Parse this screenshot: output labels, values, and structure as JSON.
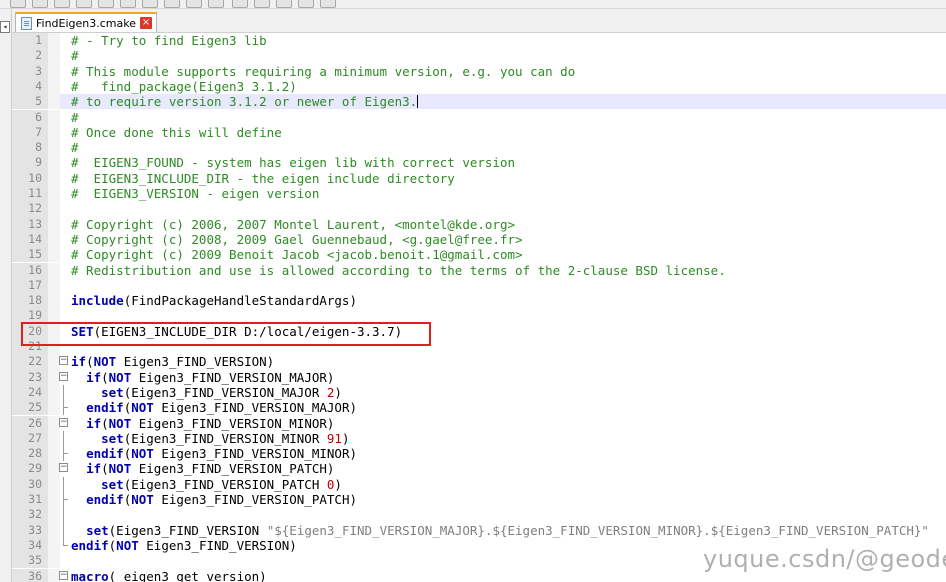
{
  "tab": {
    "label": "FindEigen3.cmake",
    "close_glyph": "×"
  },
  "watermark": "yuque.csdn/@geodev",
  "colors": {
    "comment": "#2e8b24",
    "keyword": "#0000b0",
    "number": "#c00000",
    "current_line": "#e8e8ff",
    "highlight_box": "#e02020",
    "tab_accent": "#f6a623"
  },
  "current_line": 5,
  "highlighted_line": 20,
  "lines": [
    {
      "n": "1",
      "tokens": [
        {
          "t": "# - Try to find Eigen3 lib",
          "c": "c"
        }
      ]
    },
    {
      "n": "2",
      "tokens": [
        {
          "t": "#",
          "c": "c"
        }
      ]
    },
    {
      "n": "3",
      "tokens": [
        {
          "t": "# This module supports requiring a minimum version, e.g. you can do",
          "c": "c"
        }
      ]
    },
    {
      "n": "4",
      "tokens": [
        {
          "t": "#   find_package(Eigen3 3.1.2)",
          "c": "c"
        }
      ]
    },
    {
      "n": "5",
      "tokens": [
        {
          "t": "# to require version 3.1.2 or newer of Eigen3.",
          "c": "c"
        }
      ]
    },
    {
      "n": "6",
      "tokens": [
        {
          "t": "#",
          "c": "c"
        }
      ]
    },
    {
      "n": "7",
      "tokens": [
        {
          "t": "# Once done this will define",
          "c": "c"
        }
      ]
    },
    {
      "n": "8",
      "tokens": [
        {
          "t": "#",
          "c": "c"
        }
      ]
    },
    {
      "n": "9",
      "tokens": [
        {
          "t": "#  EIGEN3_FOUND - system has eigen lib with correct version",
          "c": "c"
        }
      ]
    },
    {
      "n": "10",
      "tokens": [
        {
          "t": "#  EIGEN3_INCLUDE_DIR - the eigen include directory",
          "c": "c"
        }
      ]
    },
    {
      "n": "11",
      "tokens": [
        {
          "t": "#  EIGEN3_VERSION - eigen version",
          "c": "c"
        }
      ]
    },
    {
      "n": "12",
      "tokens": []
    },
    {
      "n": "13",
      "tokens": [
        {
          "t": "# Copyright (c) 2006, 2007 Montel Laurent, <montel@kde.org>",
          "c": "c"
        }
      ]
    },
    {
      "n": "14",
      "tokens": [
        {
          "t": "# Copyright (c) 2008, 2009 Gael Guennebaud, <g.gael@free.fr>",
          "c": "c"
        }
      ]
    },
    {
      "n": "15",
      "tokens": [
        {
          "t": "# Copyright (c) 2009 Benoit Jacob <jacob.benoit.1@gmail.com>",
          "c": "c"
        }
      ]
    },
    {
      "n": "16",
      "tokens": [
        {
          "t": "# Redistribution and use is allowed according to the terms of the 2-clause BSD license.",
          "c": "c"
        }
      ]
    },
    {
      "n": "17",
      "tokens": []
    },
    {
      "n": "18",
      "tokens": [
        {
          "t": "include",
          "c": "k"
        },
        {
          "t": "(FindPackageHandleStandardArgs)",
          "c": ""
        }
      ]
    },
    {
      "n": "19",
      "tokens": []
    },
    {
      "n": "20",
      "tokens": [
        {
          "t": "SET",
          "c": "k"
        },
        {
          "t": "(EIGEN3_INCLUDE_DIR D:/local/eigen-3.3.7)",
          "c": ""
        }
      ]
    },
    {
      "n": "21",
      "tokens": []
    },
    {
      "n": "22",
      "tokens": [
        {
          "t": "if",
          "c": "k"
        },
        {
          "t": "(",
          "c": ""
        },
        {
          "t": "NOT",
          "c": "k"
        },
        {
          "t": " Eigen3_FIND_VERSION)",
          "c": ""
        }
      ]
    },
    {
      "n": "23",
      "tokens": [
        {
          "t": "  ",
          "c": ""
        },
        {
          "t": "if",
          "c": "k"
        },
        {
          "t": "(",
          "c": ""
        },
        {
          "t": "NOT",
          "c": "k"
        },
        {
          "t": " Eigen3_FIND_VERSION_MAJOR)",
          "c": ""
        }
      ]
    },
    {
      "n": "24",
      "tokens": [
        {
          "t": "    ",
          "c": ""
        },
        {
          "t": "set",
          "c": "k"
        },
        {
          "t": "(Eigen3_FIND_VERSION_MAJOR ",
          "c": ""
        },
        {
          "t": "2",
          "c": "n"
        },
        {
          "t": ")",
          "c": ""
        }
      ]
    },
    {
      "n": "25",
      "tokens": [
        {
          "t": "  ",
          "c": ""
        },
        {
          "t": "endif",
          "c": "k"
        },
        {
          "t": "(",
          "c": ""
        },
        {
          "t": "NOT",
          "c": "k"
        },
        {
          "t": " Eigen3_FIND_VERSION_MAJOR)",
          "c": ""
        }
      ]
    },
    {
      "n": "26",
      "tokens": [
        {
          "t": "  ",
          "c": ""
        },
        {
          "t": "if",
          "c": "k"
        },
        {
          "t": "(",
          "c": ""
        },
        {
          "t": "NOT",
          "c": "k"
        },
        {
          "t": " Eigen3_FIND_VERSION_MINOR)",
          "c": ""
        }
      ]
    },
    {
      "n": "27",
      "tokens": [
        {
          "t": "    ",
          "c": ""
        },
        {
          "t": "set",
          "c": "k"
        },
        {
          "t": "(Eigen3_FIND_VERSION_MINOR ",
          "c": ""
        },
        {
          "t": "91",
          "c": "n"
        },
        {
          "t": ")",
          "c": ""
        }
      ]
    },
    {
      "n": "28",
      "tokens": [
        {
          "t": "  ",
          "c": ""
        },
        {
          "t": "endif",
          "c": "k"
        },
        {
          "t": "(",
          "c": ""
        },
        {
          "t": "NOT",
          "c": "k"
        },
        {
          "t": " Eigen3_FIND_VERSION_MINOR)",
          "c": ""
        }
      ]
    },
    {
      "n": "29",
      "tokens": [
        {
          "t": "  ",
          "c": ""
        },
        {
          "t": "if",
          "c": "k"
        },
        {
          "t": "(",
          "c": ""
        },
        {
          "t": "NOT",
          "c": "k"
        },
        {
          "t": " Eigen3_FIND_VERSION_PATCH)",
          "c": ""
        }
      ]
    },
    {
      "n": "30",
      "tokens": [
        {
          "t": "    ",
          "c": ""
        },
        {
          "t": "set",
          "c": "k"
        },
        {
          "t": "(Eigen3_FIND_VERSION_PATCH ",
          "c": ""
        },
        {
          "t": "0",
          "c": "n"
        },
        {
          "t": ")",
          "c": ""
        }
      ]
    },
    {
      "n": "31",
      "tokens": [
        {
          "t": "  ",
          "c": ""
        },
        {
          "t": "endif",
          "c": "k"
        },
        {
          "t": "(",
          "c": ""
        },
        {
          "t": "NOT",
          "c": "k"
        },
        {
          "t": " Eigen3_FIND_VERSION_PATCH)",
          "c": ""
        }
      ]
    },
    {
      "n": "32",
      "tokens": []
    },
    {
      "n": "33",
      "tokens": [
        {
          "t": "  ",
          "c": ""
        },
        {
          "t": "set",
          "c": "k"
        },
        {
          "t": "(Eigen3_FIND_VERSION ",
          "c": ""
        },
        {
          "t": "\"${Eigen3_FIND_VERSION_MAJOR}.${Eigen3_FIND_VERSION_MINOR}.${Eigen3_FIND_VERSION_PATCH}\"",
          "c": "s"
        }
      ]
    },
    {
      "n": "34",
      "tokens": [
        {
          "t": "endif",
          "c": "k"
        },
        {
          "t": "(",
          "c": ""
        },
        {
          "t": "NOT",
          "c": "k"
        },
        {
          "t": " Eigen3_FIND_VERSION)",
          "c": ""
        }
      ]
    },
    {
      "n": "35",
      "tokens": []
    },
    {
      "n": "36",
      "tokens": [
        {
          "t": "macro",
          "c": "k"
        },
        {
          "t": "(_eigen3_get_version)",
          "c": ""
        }
      ]
    }
  ]
}
